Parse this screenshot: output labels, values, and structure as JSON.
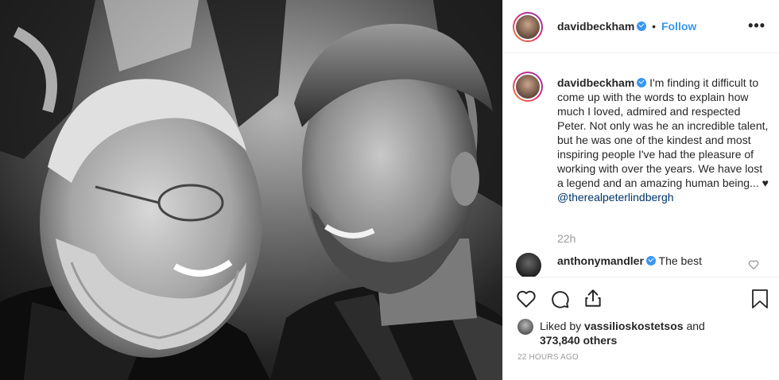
{
  "post": {
    "username": "davidbeckham",
    "follow_label": "Follow",
    "separator": "•",
    "more_label": "•••",
    "caption": "I'm finding it difficult to come up with the words to explain how much I loved, admired and respected Peter. Not only was he an incredible talent, but he was one of the kindest and most inspiring people I've had the pleasure of working with over the years. We have lost a legend and an amazing human being... ♥",
    "caption_mention": "@therealpeterlindbergh",
    "time": "22h"
  },
  "comment": {
    "username": "anthonymandler",
    "text": "The best"
  },
  "likes": {
    "prefix": "Liked by",
    "user": "vassilioskostetsos",
    "and": "and",
    "count": "373,840 others"
  },
  "timestamp": "22 HOURS AGO",
  "colors": {
    "accent": "#3897f0",
    "mention": "#003569",
    "muted": "#999999",
    "text": "#262626"
  },
  "icons": [
    "heart-icon",
    "comment-icon",
    "share-icon",
    "bookmark-icon",
    "verified-badge-icon",
    "more-options-icon"
  ]
}
